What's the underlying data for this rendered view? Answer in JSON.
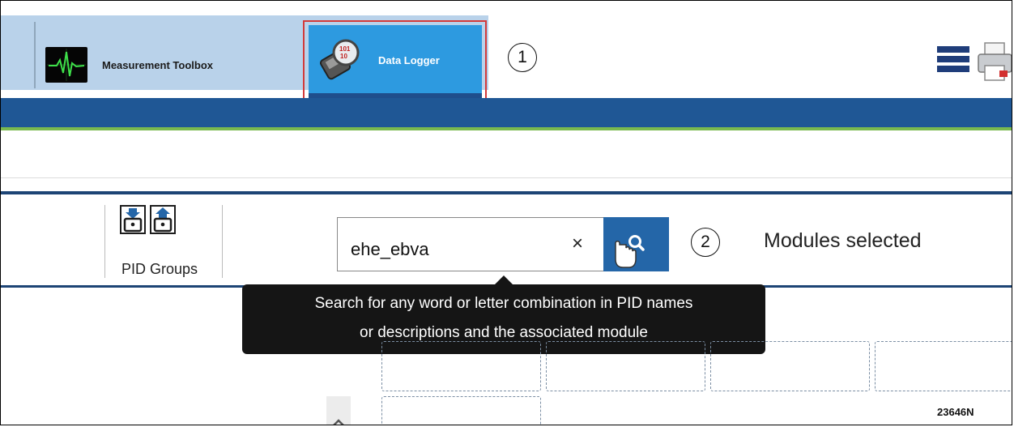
{
  "toolbar": {
    "tabs": [
      {
        "label": "Measurement Toolbox",
        "icon": "oscilloscope-icon"
      },
      {
        "label": "Data Logger",
        "icon": "data-logger-icon",
        "active": true
      }
    ]
  },
  "callouts": {
    "one": "1",
    "two": "2"
  },
  "pid_groups": {
    "label": "PID Groups"
  },
  "search": {
    "value": "ehe_ebva",
    "clear_label": "×",
    "modules_label": "Modules selected"
  },
  "tooltip": {
    "line1": "Search for any word or letter combination in PID names",
    "line2": "or descriptions and the associated module"
  },
  "figure_id": "23646N",
  "colors": {
    "toolbar": "#b9d2ea",
    "active_tab": "#2d9ae0",
    "header_band": "#1f5795",
    "green_band": "#79b94f",
    "search_button": "#2466a8",
    "highlight": "#d33a3a",
    "tooltip_bg": "#151515"
  }
}
